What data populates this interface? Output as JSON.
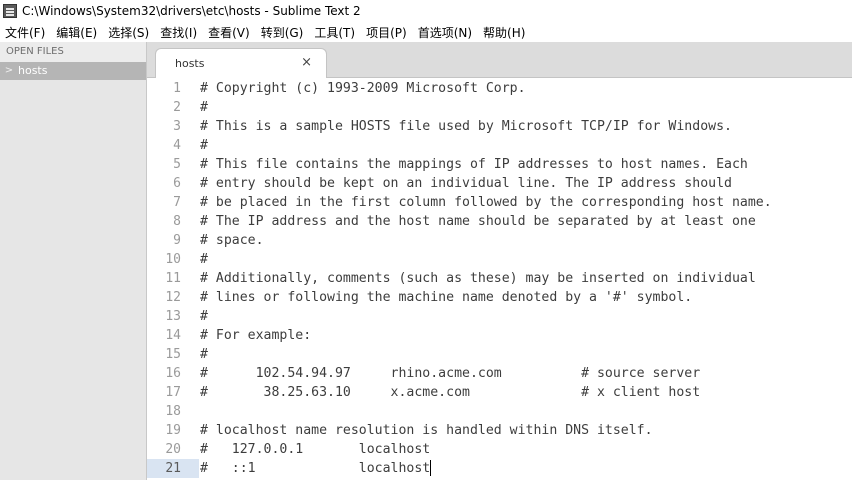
{
  "window": {
    "title": "C:\\Windows\\System32\\drivers\\etc\\hosts - Sublime Text 2"
  },
  "menu": {
    "items": [
      "文件(F)",
      "编辑(E)",
      "选择(S)",
      "查找(I)",
      "查看(V)",
      "转到(G)",
      "工具(T)",
      "项目(P)",
      "首选项(N)",
      "帮助(H)"
    ]
  },
  "sidebar": {
    "header": "OPEN FILES",
    "files": [
      {
        "chevron": ">",
        "name": "hosts"
      }
    ]
  },
  "tabs": [
    {
      "label": "hosts",
      "close": "×"
    }
  ],
  "editor": {
    "current_line": 21,
    "lines": [
      {
        "n": "1",
        "text": "# Copyright (c) 1993-2009 Microsoft Corp."
      },
      {
        "n": "2",
        "text": "#"
      },
      {
        "n": "3",
        "text": "# This is a sample HOSTS file used by Microsoft TCP/IP for Windows."
      },
      {
        "n": "4",
        "text": "#"
      },
      {
        "n": "5",
        "text": "# This file contains the mappings of IP addresses to host names. Each"
      },
      {
        "n": "6",
        "text": "# entry should be kept on an individual line. The IP address should"
      },
      {
        "n": "7",
        "text": "# be placed in the first column followed by the corresponding host name."
      },
      {
        "n": "8",
        "text": "# The IP address and the host name should be separated by at least one"
      },
      {
        "n": "9",
        "text": "# space."
      },
      {
        "n": "10",
        "text": "#"
      },
      {
        "n": "11",
        "text": "# Additionally, comments (such as these) may be inserted on individual"
      },
      {
        "n": "12",
        "text": "# lines or following the machine name denoted by a '#' symbol."
      },
      {
        "n": "13",
        "text": "#"
      },
      {
        "n": "14",
        "text": "# For example:"
      },
      {
        "n": "15",
        "text": "#"
      },
      {
        "n": "16",
        "text": "#      102.54.94.97     rhino.acme.com          # source server"
      },
      {
        "n": "17",
        "text": "#       38.25.63.10     x.acme.com              # x client host"
      },
      {
        "n": "18",
        "text": ""
      },
      {
        "n": "19",
        "text": "# localhost name resolution is handled within DNS itself."
      },
      {
        "n": "20",
        "text": "#   127.0.0.1       localhost"
      },
      {
        "n": "21",
        "text": "#   ::1             localhost"
      }
    ]
  }
}
